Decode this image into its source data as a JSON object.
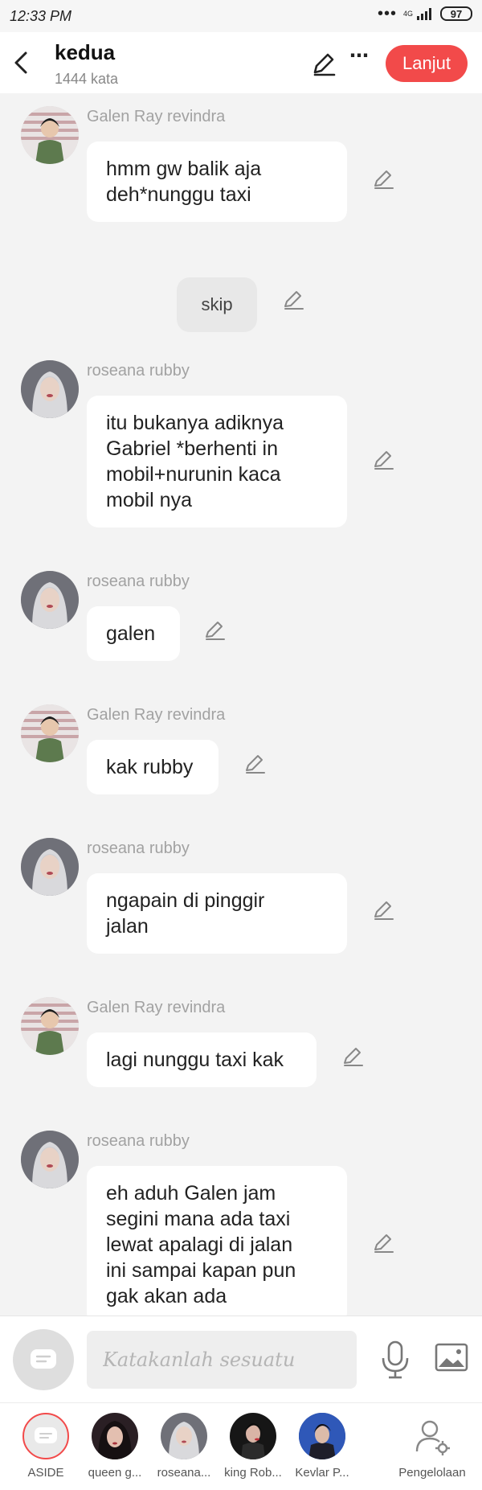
{
  "status_bar": {
    "time": "12:33 PM",
    "dots": "•••",
    "network": "4G",
    "battery": "97"
  },
  "header": {
    "title": "kedua",
    "word_count": "1444 kata",
    "next_label": "Lanjut"
  },
  "messages": [
    {
      "sender": "Galen Ray revindra",
      "text": "hmm gw balik aja\ndeh*nunggu taxi"
    },
    {
      "narration": "skip"
    },
    {
      "sender": "roseana rubby",
      "text": "itu bukanya adiknya\nGabriel *berhenti in\nmobil+nurunin kaca\nmobil nya"
    },
    {
      "sender": "roseana rubby",
      "text": "galen"
    },
    {
      "sender": "Galen Ray revindra",
      "text": "kak rubby"
    },
    {
      "sender": "roseana rubby",
      "text": "ngapain di pinggir\njalan"
    },
    {
      "sender": "Galen Ray revindra",
      "text": "lagi nunggu taxi kak"
    },
    {
      "sender": "roseana rubby",
      "text": "eh aduh Galen jam\nsegini mana ada taxi\nlewat apalagi di jalan\nini sampai kapan pun\ngak akan ada"
    }
  ],
  "input": {
    "placeholder": "Katakanlah sesuatu"
  },
  "characters": [
    {
      "label": "ASIDE"
    },
    {
      "label": "queen g..."
    },
    {
      "label": "roseana..."
    },
    {
      "label": "king Rob..."
    },
    {
      "label": "Kevlar P..."
    },
    {
      "label": "Pengelolaan"
    }
  ],
  "colors": {
    "accent": "#f24a4a",
    "background": "#f3f3f3",
    "bubble": "#ffffff",
    "sender_text": "#a2a2a2"
  }
}
